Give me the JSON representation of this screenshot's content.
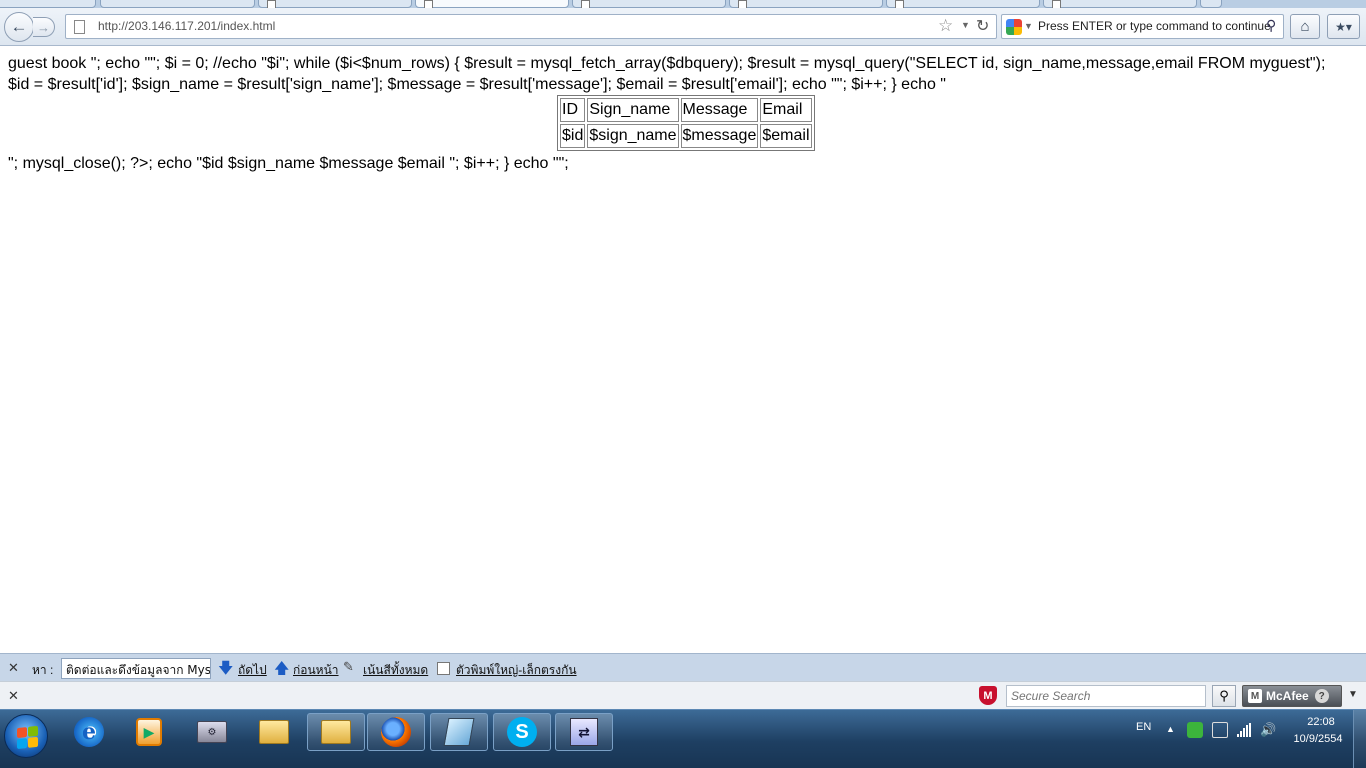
{
  "browser": {
    "url": "http://203.146.117.201/index.html",
    "search_text": "Press ENTER or type command to continue",
    "back_glyph": "←",
    "forward_glyph": "→"
  },
  "page": {
    "line1": "guest book \"; echo \"\"; $i = 0; //echo \"$i\"; while ($i<$num_rows) { $result = mysql_fetch_array($dbquery); $result = mysql_query(\"SELECT id, sign_name,message,email FROM myguest\");",
    "line2": "$id = $result['id']; $sign_name = $result['sign_name']; $message = $result['message']; $email = $result['email']; echo \"\"; $i++; } echo \"",
    "line3": "\"; mysql_close(); ?>; echo \"$id $sign_name $message $email \"; $i++; } echo \"\";",
    "table": {
      "headers": [
        "ID",
        "Sign_name",
        "Message",
        "Email"
      ],
      "row": [
        "$id",
        "$sign_name",
        "$message",
        "$email"
      ]
    }
  },
  "findbar": {
    "label": "หา :",
    "input_value": "ติดต่อและดึงข้อมูลจาก Mysq",
    "next": "ถัดไป",
    "previous": "ก่อนหน้า",
    "highlight_all": "เน้นสีทั้งหมด",
    "match_case": "ตัวพิมพ์ใหญ่-เล็กตรงกัน"
  },
  "addonbar": {
    "secure_search_placeholder": "Secure Search",
    "mcafee_label": "McAfee"
  },
  "taskbar": {
    "language": "EN",
    "time": "22:08",
    "date": "10/9/2554"
  },
  "colors": {
    "taskbar": "#1e3f62",
    "findbar": "#c7d6e8",
    "mcafee_red": "#c8102e",
    "link_blue": "#1c5cc4"
  }
}
